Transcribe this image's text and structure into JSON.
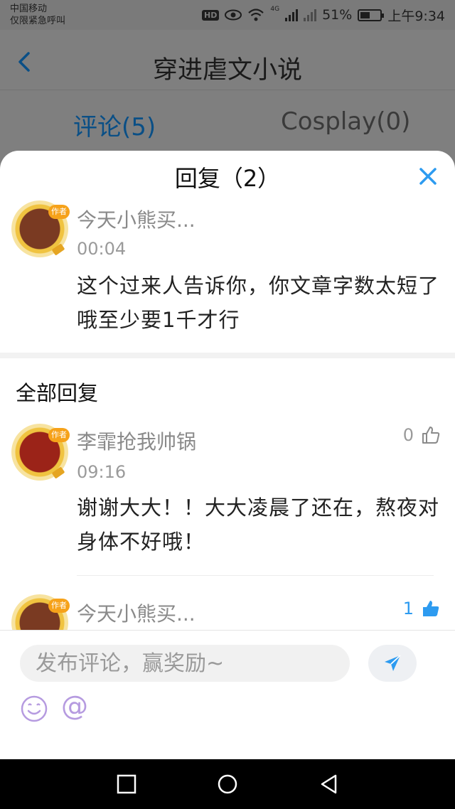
{
  "status_bar": {
    "carrier_line1": "中国移动",
    "carrier_line2": "仅限紧急呼叫",
    "hd": "HD",
    "network": "4G",
    "battery": "51%",
    "battery_level": 0.51,
    "time": "上午9:34"
  },
  "page": {
    "title": "穿进虐文小说",
    "tabs": [
      {
        "label": "评论(5)",
        "active": true
      },
      {
        "label": "Cosplay(0)",
        "active": false
      }
    ]
  },
  "sheet": {
    "title": "回复（2）",
    "original": {
      "user": "今天小熊买...",
      "time": "00:04",
      "text": "这个过来人告诉你，你文章字数太短了哦至少要1千才行"
    },
    "replies_heading": "全部回复",
    "replies": [
      {
        "user": "李霏抢我帅锅",
        "time": "09:16",
        "text": "谢谢大大！！大大凌晨了还在，熬夜对身体不好哦！",
        "likes": "0",
        "liked": false
      },
      {
        "user": "今天小熊买...",
        "likes": "1",
        "liked": true
      }
    ],
    "badge": "作者"
  },
  "composer": {
    "placeholder": "发布评论，赢奖励~",
    "at_symbol": "@"
  },
  "colors": {
    "accent_blue": "#2d9bf0",
    "active_tab": "#0a4f86",
    "emoji_purple": "#b69be0"
  }
}
